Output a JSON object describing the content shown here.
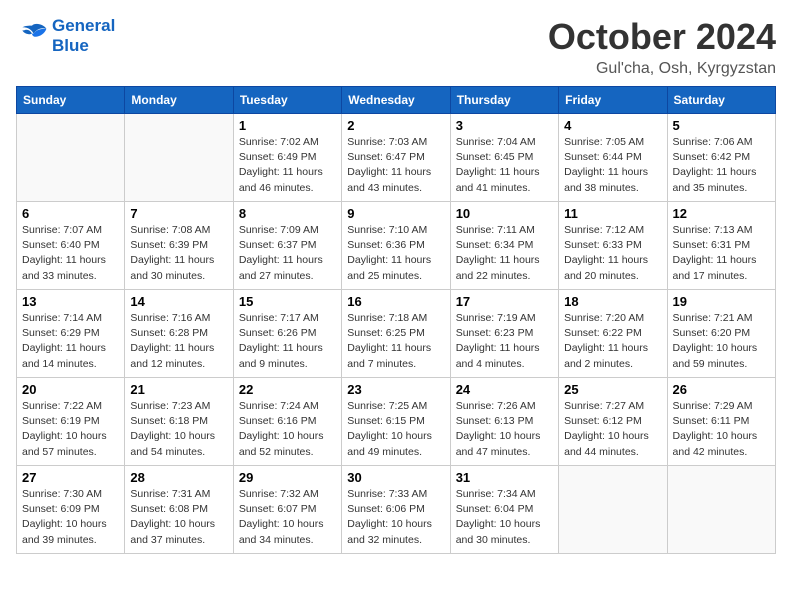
{
  "header": {
    "logo_line1": "General",
    "logo_line2": "Blue",
    "month": "October 2024",
    "location": "Gul'cha, Osh, Kyrgyzstan"
  },
  "days_of_week": [
    "Sunday",
    "Monday",
    "Tuesday",
    "Wednesday",
    "Thursday",
    "Friday",
    "Saturday"
  ],
  "weeks": [
    [
      {
        "num": "",
        "detail": ""
      },
      {
        "num": "",
        "detail": ""
      },
      {
        "num": "1",
        "detail": "Sunrise: 7:02 AM\nSunset: 6:49 PM\nDaylight: 11 hours and 46 minutes."
      },
      {
        "num": "2",
        "detail": "Sunrise: 7:03 AM\nSunset: 6:47 PM\nDaylight: 11 hours and 43 minutes."
      },
      {
        "num": "3",
        "detail": "Sunrise: 7:04 AM\nSunset: 6:45 PM\nDaylight: 11 hours and 41 minutes."
      },
      {
        "num": "4",
        "detail": "Sunrise: 7:05 AM\nSunset: 6:44 PM\nDaylight: 11 hours and 38 minutes."
      },
      {
        "num": "5",
        "detail": "Sunrise: 7:06 AM\nSunset: 6:42 PM\nDaylight: 11 hours and 35 minutes."
      }
    ],
    [
      {
        "num": "6",
        "detail": "Sunrise: 7:07 AM\nSunset: 6:40 PM\nDaylight: 11 hours and 33 minutes."
      },
      {
        "num": "7",
        "detail": "Sunrise: 7:08 AM\nSunset: 6:39 PM\nDaylight: 11 hours and 30 minutes."
      },
      {
        "num": "8",
        "detail": "Sunrise: 7:09 AM\nSunset: 6:37 PM\nDaylight: 11 hours and 27 minutes."
      },
      {
        "num": "9",
        "detail": "Sunrise: 7:10 AM\nSunset: 6:36 PM\nDaylight: 11 hours and 25 minutes."
      },
      {
        "num": "10",
        "detail": "Sunrise: 7:11 AM\nSunset: 6:34 PM\nDaylight: 11 hours and 22 minutes."
      },
      {
        "num": "11",
        "detail": "Sunrise: 7:12 AM\nSunset: 6:33 PM\nDaylight: 11 hours and 20 minutes."
      },
      {
        "num": "12",
        "detail": "Sunrise: 7:13 AM\nSunset: 6:31 PM\nDaylight: 11 hours and 17 minutes."
      }
    ],
    [
      {
        "num": "13",
        "detail": "Sunrise: 7:14 AM\nSunset: 6:29 PM\nDaylight: 11 hours and 14 minutes."
      },
      {
        "num": "14",
        "detail": "Sunrise: 7:16 AM\nSunset: 6:28 PM\nDaylight: 11 hours and 12 minutes."
      },
      {
        "num": "15",
        "detail": "Sunrise: 7:17 AM\nSunset: 6:26 PM\nDaylight: 11 hours and 9 minutes."
      },
      {
        "num": "16",
        "detail": "Sunrise: 7:18 AM\nSunset: 6:25 PM\nDaylight: 11 hours and 7 minutes."
      },
      {
        "num": "17",
        "detail": "Sunrise: 7:19 AM\nSunset: 6:23 PM\nDaylight: 11 hours and 4 minutes."
      },
      {
        "num": "18",
        "detail": "Sunrise: 7:20 AM\nSunset: 6:22 PM\nDaylight: 11 hours and 2 minutes."
      },
      {
        "num": "19",
        "detail": "Sunrise: 7:21 AM\nSunset: 6:20 PM\nDaylight: 10 hours and 59 minutes."
      }
    ],
    [
      {
        "num": "20",
        "detail": "Sunrise: 7:22 AM\nSunset: 6:19 PM\nDaylight: 10 hours and 57 minutes."
      },
      {
        "num": "21",
        "detail": "Sunrise: 7:23 AM\nSunset: 6:18 PM\nDaylight: 10 hours and 54 minutes."
      },
      {
        "num": "22",
        "detail": "Sunrise: 7:24 AM\nSunset: 6:16 PM\nDaylight: 10 hours and 52 minutes."
      },
      {
        "num": "23",
        "detail": "Sunrise: 7:25 AM\nSunset: 6:15 PM\nDaylight: 10 hours and 49 minutes."
      },
      {
        "num": "24",
        "detail": "Sunrise: 7:26 AM\nSunset: 6:13 PM\nDaylight: 10 hours and 47 minutes."
      },
      {
        "num": "25",
        "detail": "Sunrise: 7:27 AM\nSunset: 6:12 PM\nDaylight: 10 hours and 44 minutes."
      },
      {
        "num": "26",
        "detail": "Sunrise: 7:29 AM\nSunset: 6:11 PM\nDaylight: 10 hours and 42 minutes."
      }
    ],
    [
      {
        "num": "27",
        "detail": "Sunrise: 7:30 AM\nSunset: 6:09 PM\nDaylight: 10 hours and 39 minutes."
      },
      {
        "num": "28",
        "detail": "Sunrise: 7:31 AM\nSunset: 6:08 PM\nDaylight: 10 hours and 37 minutes."
      },
      {
        "num": "29",
        "detail": "Sunrise: 7:32 AM\nSunset: 6:07 PM\nDaylight: 10 hours and 34 minutes."
      },
      {
        "num": "30",
        "detail": "Sunrise: 7:33 AM\nSunset: 6:06 PM\nDaylight: 10 hours and 32 minutes."
      },
      {
        "num": "31",
        "detail": "Sunrise: 7:34 AM\nSunset: 6:04 PM\nDaylight: 10 hours and 30 minutes."
      },
      {
        "num": "",
        "detail": ""
      },
      {
        "num": "",
        "detail": ""
      }
    ]
  ]
}
